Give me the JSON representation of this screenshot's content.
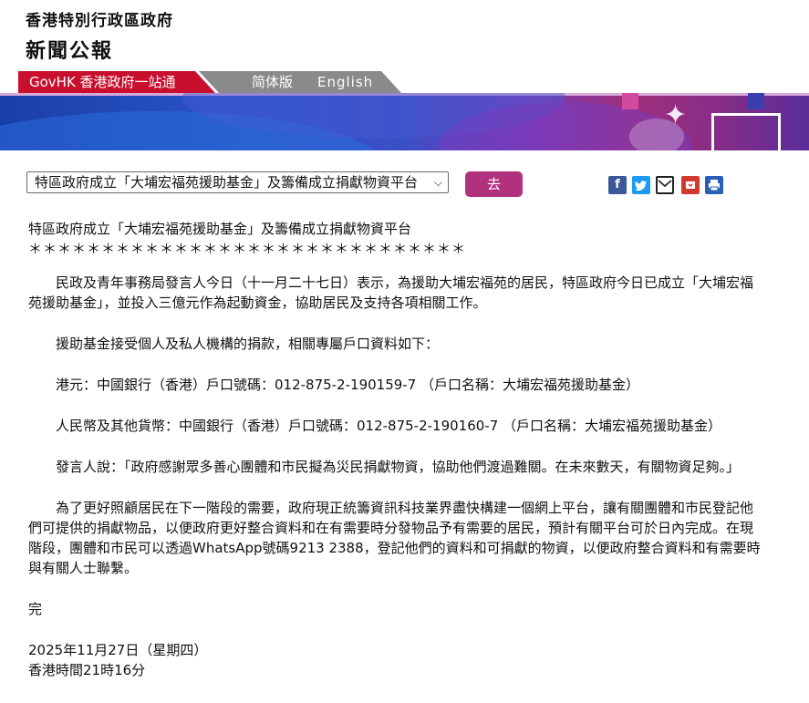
{
  "header": {
    "gov_title": "香港特別行政區政府",
    "press_title": "新聞公報"
  },
  "nav": {
    "govhk": "GovHK 香港政府一站通",
    "simplified": "简体版",
    "english": "English"
  },
  "toolbar": {
    "select_value": "特區政府成立「大埔宏福苑援助基金」及籌備成立捐獻物資平台",
    "go_label": "去"
  },
  "share_icons": [
    "facebook-icon",
    "twitter-icon",
    "email-icon",
    "bookmark-icon",
    "print-icon"
  ],
  "article": {
    "title": "特區政府成立「大埔宏福苑援助基金」及籌備成立捐獻物資平台",
    "stars": "＊＊＊＊＊＊＊＊＊＊＊＊＊＊＊＊＊＊＊＊＊＊＊＊＊＊＊＊＊＊",
    "paragraphs": [
      "民政及青年事務局發言人今日（十一月二十七日）表示，為援助大埔宏福苑的居民，特區政府今日已成立「大埔宏福苑援助基金」，並投入三億元作為起動資金，協助居民及支持各項相關工作。",
      "援助基金接受個人及私人機構的捐款，相關專屬戶口資料如下：",
      "港元：中國銀行（香港）戶口號碼：012-875-2-190159-7 （戶口名稱：大埔宏福苑援助基金）",
      "人民幣及其他貨幣：中國銀行（香港）戶口號碼：012-875-2-190160-7 （戶口名稱：大埔宏福苑援助基金）",
      "發言人說：「政府感謝眾多善心團體和市民擬為災民捐獻物資，協助他們渡過難關。在未來數天，有關物資足夠。」",
      "為了更好照顧居民在下一階段的需要，政府現正統籌資訊科技業界盡快構建一個網上平台，讓有關團體和市民登記他們可提供的捐獻物品，以便政府更好整合資料和在有需要時分發物品予有需要的居民，預計有關平台可於日內完成。在現階段，團體和市民可以透過WhatsApp號碼9213 2388，登記他們的資料和可捐獻的物資，以便政府整合資料和有需要時與有關人士聯繫。"
    ],
    "end_mark": "完",
    "date": "2025年11月27日（星期四）",
    "time": "香港時間21時16分"
  },
  "colors": {
    "govhk_red": "#c8102e",
    "go_button": "#b2317c",
    "nav_grey": "#8a8a8a"
  }
}
